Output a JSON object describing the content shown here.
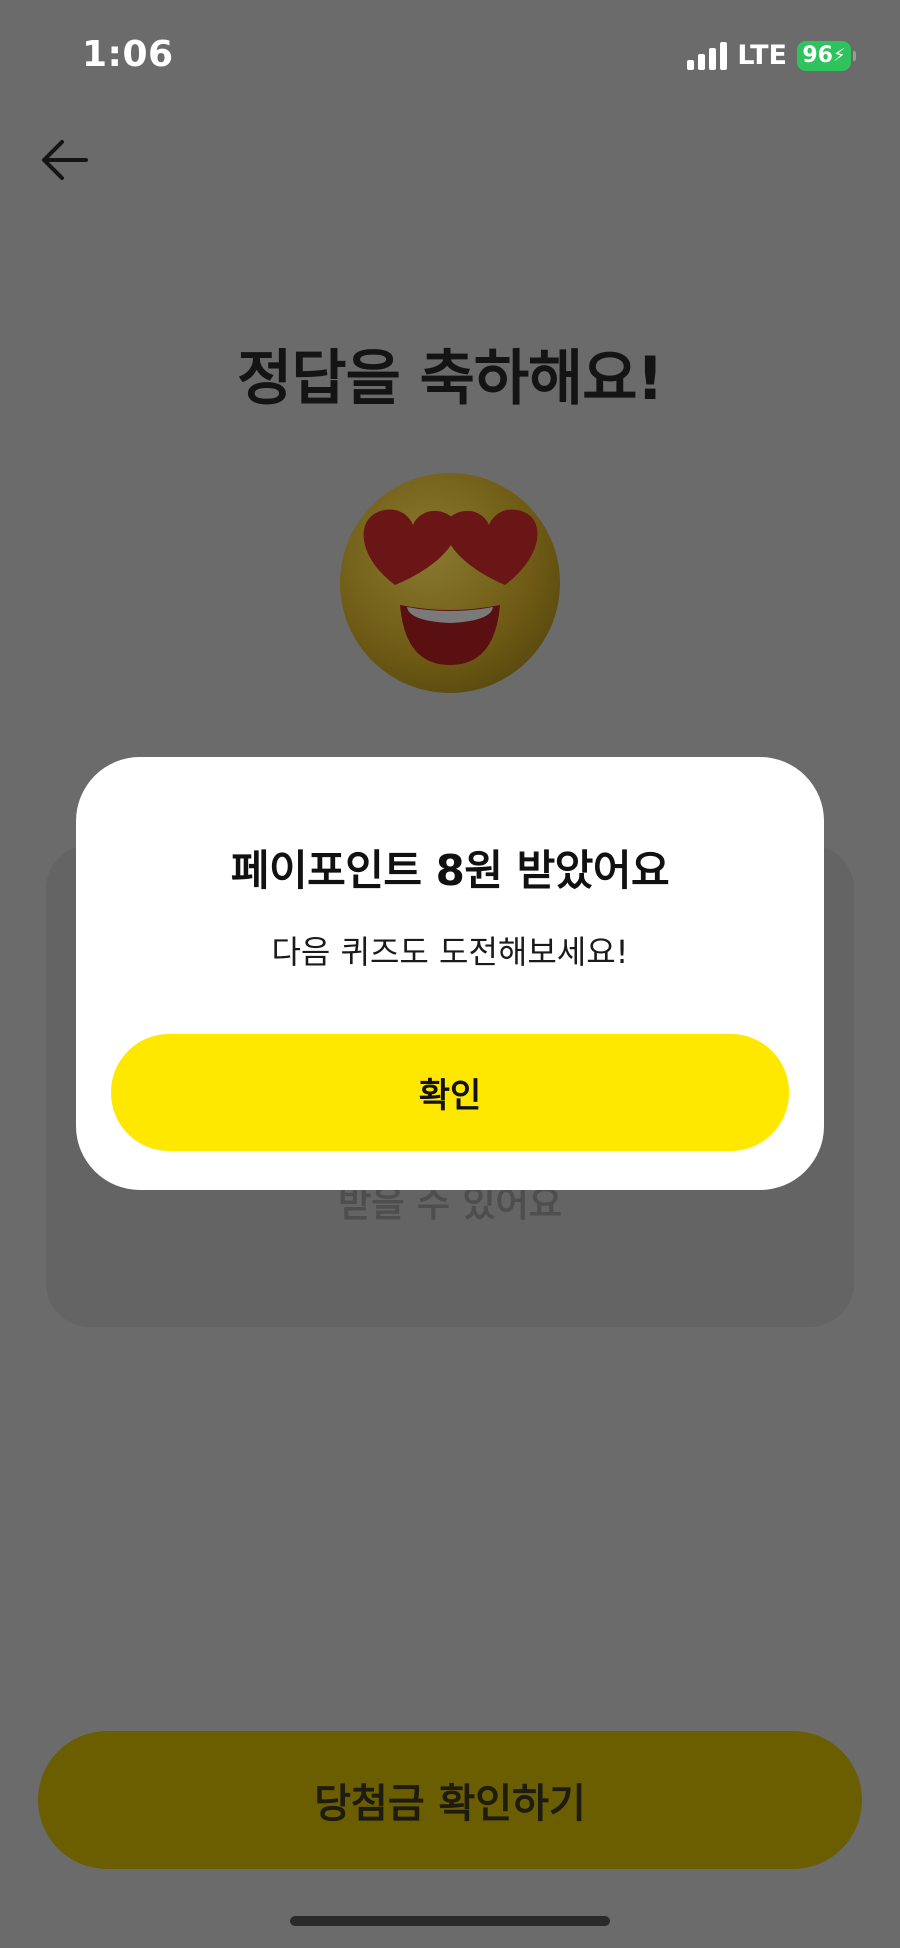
{
  "status_bar": {
    "time": "1:06",
    "network": "LTE",
    "battery": "96"
  },
  "page": {
    "title": "정답을 축하해요!",
    "card_text": "받을 수 있어요",
    "bottom_button_label": "당첨금 확인하기"
  },
  "modal": {
    "title": "페이포인트 8원 받았어요",
    "subtitle": "다음 퀴즈도 도전해보세요!",
    "confirm_label": "확인"
  },
  "icons": {
    "back": "arrow-left-icon",
    "emoji": "heart-eyes-emoji-icon",
    "signal": "signal-icon",
    "battery": "battery-charging-icon"
  },
  "colors": {
    "accent_yellow": "#ffe800",
    "battery_green": "#2ec35c",
    "dim_overlay": "#6b6b6b"
  }
}
